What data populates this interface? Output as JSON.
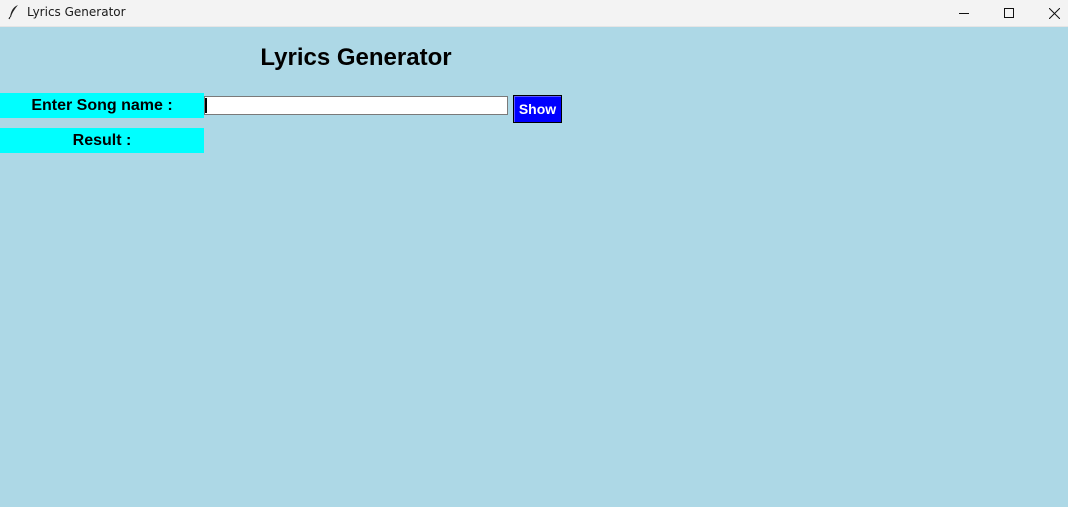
{
  "window": {
    "title": "Lyrics Generator",
    "icon": "feather-icon",
    "controls": [
      "minimize-icon",
      "maximize-icon",
      "close-icon"
    ]
  },
  "main": {
    "heading": "Lyrics Generator",
    "song_label": "Enter Song name :",
    "song_input_value": "",
    "show_button": "Show",
    "result_label": "Result :"
  },
  "colors": {
    "background": "#add8e6",
    "label_background": "#00ffff",
    "button_background": "#0000ff",
    "button_text": "#ffffff"
  }
}
